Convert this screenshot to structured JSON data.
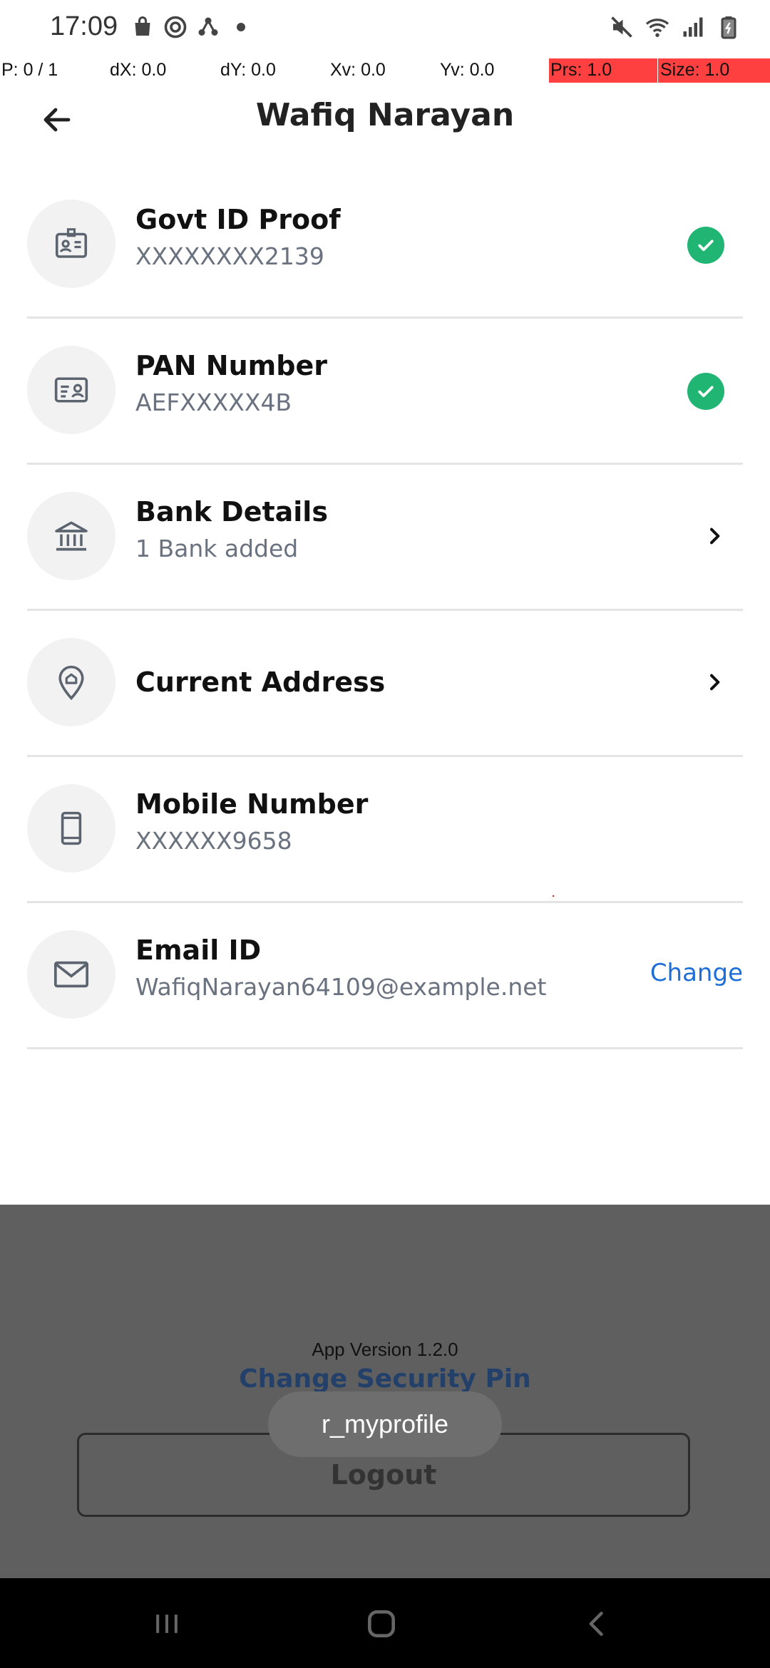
{
  "status_bar": {
    "time": "17:09",
    "left_icons": [
      "shopping-bag-icon",
      "sync-icon",
      "share-icon",
      "dot-icon"
    ],
    "right_icons": [
      "mute-icon",
      "wifi-icon",
      "signal-icon",
      "battery-icon"
    ]
  },
  "debug_overlay": {
    "p": "P: 0 / 1",
    "dx": "dX: 0.0",
    "dy": "dY: 0.0",
    "xv": "Xv: 0.0",
    "yv": "Yv: 0.0",
    "prs": "Prs: 1.0",
    "size": "Size: 1.0",
    "highlight_color": "#ff4040"
  },
  "header": {
    "title": "Wafiq Narayan",
    "back_icon": "arrow-left-icon"
  },
  "profile_items": [
    {
      "title": "Govt ID Proof",
      "subtitle": "XXXXXXXX2139",
      "icon": "id-card-icon",
      "trailing": "check"
    },
    {
      "title": "PAN Number",
      "subtitle": "AEFXXXXX4B",
      "icon": "pan-card-icon",
      "trailing": "check"
    },
    {
      "title": "Bank Details",
      "subtitle": "1 Bank added",
      "icon": "bank-icon",
      "trailing": "chevron"
    },
    {
      "title": "Current Address",
      "subtitle": "",
      "icon": "location-pin-icon",
      "trailing": "chevron"
    },
    {
      "title": "Mobile Number",
      "subtitle": "XXXXXX9658",
      "icon": "mobile-icon",
      "trailing": "none"
    },
    {
      "title": "Email ID",
      "subtitle": "WafiqNarayan64109@example.net",
      "icon": "mail-icon",
      "trailing": "link",
      "link_label": "Change"
    }
  ],
  "footer": {
    "app_version": "App Version 1.2.0",
    "change_pin_label": "Change Security Pin",
    "logout_label": "Logout"
  },
  "toast": {
    "text": "r_myprofile"
  },
  "colors": {
    "accent_link": "#1d6ed8",
    "verified_green": "#21b573",
    "subtitle_gray": "#6a7280",
    "overlay_gray": "#5f5f5f"
  },
  "nav_bar": {
    "buttons": [
      "recents-icon",
      "home-icon",
      "back-icon"
    ]
  }
}
